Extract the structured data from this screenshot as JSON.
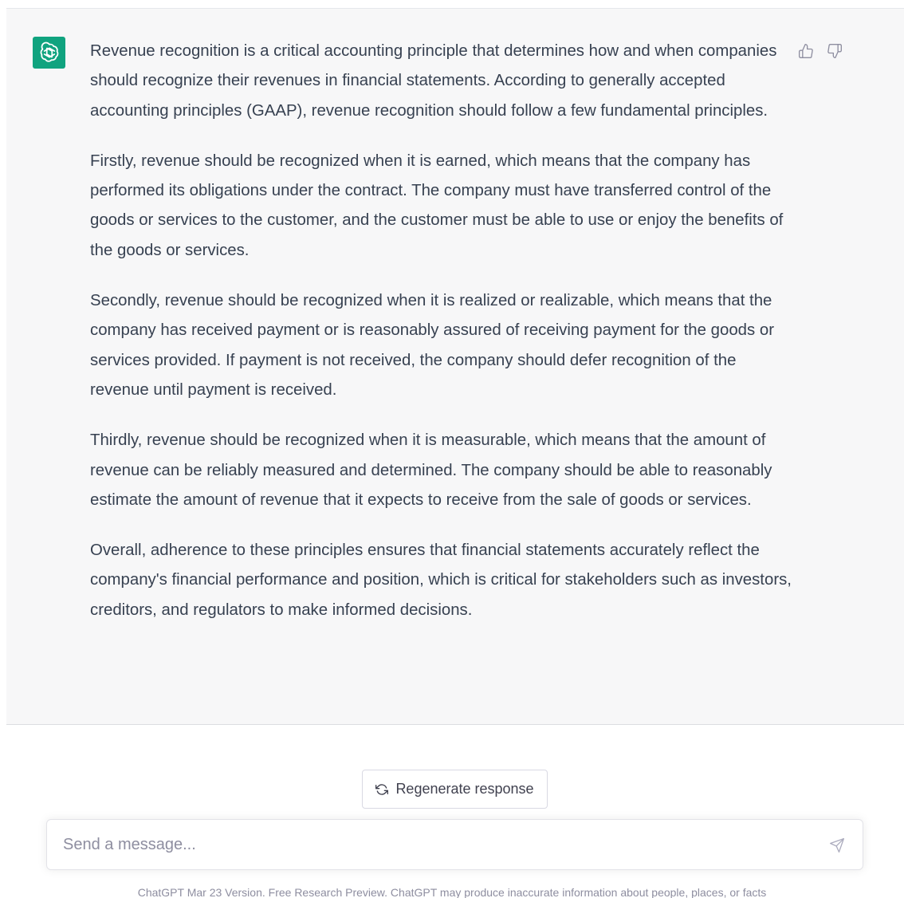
{
  "message": {
    "paragraphs": [
      "Revenue recognition is a critical accounting principle that determines how and when companies should recognize their revenues in financial statements. According to generally accepted accounting principles (GAAP), revenue recognition should follow a few fundamental principles.",
      "Firstly, revenue should be recognized when it is earned, which means that the company has performed its obligations under the contract. The company must have transferred control of the goods or services to the customer, and the customer must be able to use or enjoy the benefits of the goods or services.",
      "Secondly, revenue should be recognized when it is realized or realizable, which means that the company has received payment or is reasonably assured of receiving payment for the goods or services provided. If payment is not received, the company should defer recognition of the revenue until payment is received.",
      "Thirdly, revenue should be recognized when it is measurable, which means that the amount of revenue can be reliably measured and determined. The company should be able to reasonably estimate the amount of revenue that it expects to receive from the sale of goods or services.",
      "Overall, adherence to these principles ensures that financial statements accurately reflect the company's financial performance and position, which is critical for stakeholders such as investors, creditors, and regulators to make informed decisions."
    ]
  },
  "actions": {
    "regenerate_label": "Regenerate response"
  },
  "composer": {
    "placeholder": "Send a message...",
    "value": ""
  },
  "footer": {
    "text": "ChatGPT Mar 23 Version. Free Research Preview. ChatGPT may produce inaccurate information about people, places, or facts"
  },
  "icons": {
    "avatar": "openai-logo-icon",
    "like": "thumbs-up-icon",
    "dislike": "thumbs-down-icon",
    "regenerate": "refresh-icon",
    "send": "send-icon"
  },
  "colors": {
    "accent": "#10a37f",
    "message_bg": "#f7f7f8",
    "text": "#374151",
    "muted": "#8e8ea0"
  }
}
